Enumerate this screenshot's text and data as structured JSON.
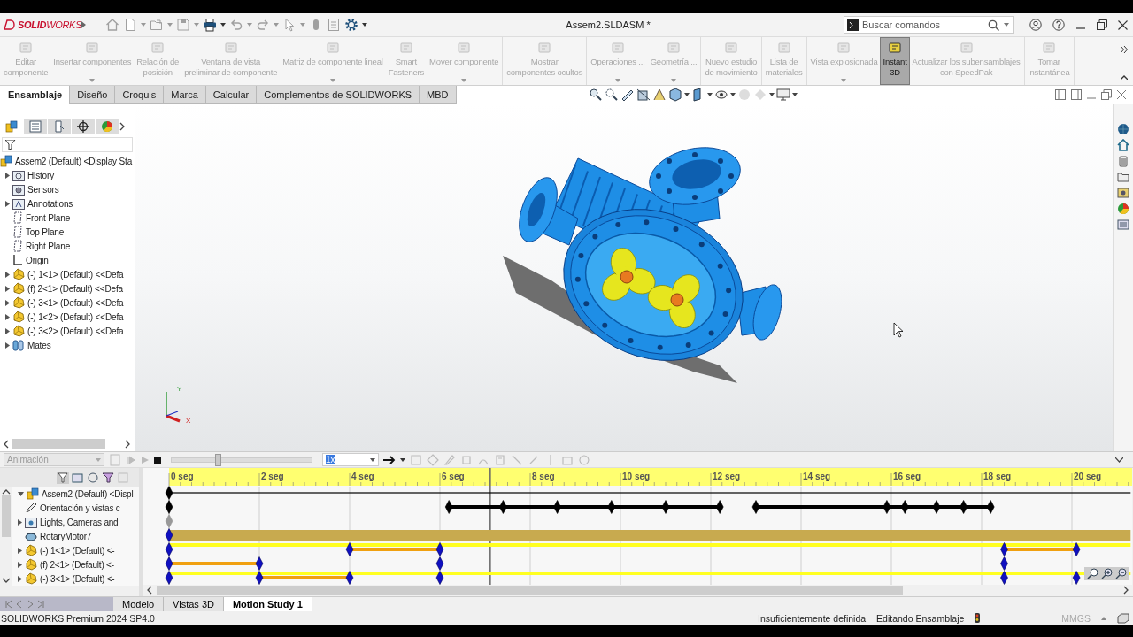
{
  "title_bar": {
    "logo": "**SOLID**WORKS",
    "title": "Assem2.SLDASM *",
    "search": {
      "placeholder": "Buscar comandos"
    },
    "quick_access": [
      {
        "kind": "home",
        "disabled": true,
        "dropdown": false
      },
      {
        "kind": "new",
        "disabled": true,
        "dropdown": true
      },
      {
        "kind": "open",
        "disabled": true,
        "dropdown": true
      },
      {
        "kind": "save",
        "disabled": true,
        "dropdown": true
      },
      {
        "kind": "print",
        "disabled": false,
        "dropdown": true
      },
      {
        "kind": "undo",
        "disabled": true,
        "dropdown": true
      },
      {
        "kind": "redo",
        "disabled": true,
        "dropdown": true
      },
      {
        "kind": "select",
        "disabled": true,
        "dropdown": true
      },
      {
        "kind": "rebuild",
        "disabled": true,
        "dropdown": false
      },
      {
        "kind": "properties",
        "disabled": true,
        "dropdown": false
      },
      {
        "kind": "options",
        "disabled": false,
        "dropdown": true
      }
    ]
  },
  "ribbon": {
    "groups": [
      [
        {
          "label": "Editar\ncomponente",
          "dropdown": false,
          "disabled": true,
          "selected": false
        },
        {
          "label": "Insertar componentes",
          "dropdown": true,
          "disabled": true,
          "selected": false
        },
        {
          "label": "Relación de\nposición",
          "dropdown": false,
          "disabled": true,
          "selected": false
        },
        {
          "label": "Ventana de vista\npreliminar de componente",
          "dropdown": false,
          "disabled": true,
          "selected": false
        },
        {
          "label": "Matriz de componente lineal",
          "dropdown": true,
          "disabled": true,
          "selected": false
        },
        {
          "label": "Smart\nFasteners",
          "dropdown": false,
          "disabled": true,
          "selected": false
        },
        {
          "label": "Mover componente",
          "dropdown": true,
          "disabled": true,
          "selected": false
        }
      ],
      [
        {
          "label": "Mostrar\ncomponentes ocultos",
          "dropdown": false,
          "disabled": true,
          "selected": false
        }
      ],
      [
        {
          "label": "Operaciones ...",
          "dropdown": true,
          "disabled": true,
          "selected": false
        },
        {
          "label": "Geometría ...",
          "dropdown": true,
          "disabled": true,
          "selected": false
        }
      ],
      [
        {
          "label": "Nuevo estudio\nde movimiento",
          "dropdown": false,
          "disabled": true,
          "selected": false
        }
      ],
      [
        {
          "label": "Lista de\nmateriales",
          "dropdown": false,
          "disabled": true,
          "selected": false
        }
      ],
      [
        {
          "label": "Vista explosionada",
          "dropdown": true,
          "disabled": true,
          "selected": false
        },
        {
          "label": "Instant\n3D",
          "dropdown": false,
          "disabled": false,
          "selected": true
        },
        {
          "label": "Actualizar los subensamblajes\ncon SpeedPak",
          "dropdown": false,
          "disabled": true,
          "selected": false
        }
      ],
      [
        {
          "label": "Tomar\ninstantánea",
          "dropdown": false,
          "disabled": true,
          "selected": false
        }
      ]
    ]
  },
  "tabs": [
    {
      "label": "Ensamblaje",
      "selected": true
    },
    {
      "label": "Diseño",
      "selected": false
    },
    {
      "label": "Croquis",
      "selected": false
    },
    {
      "label": "Marca",
      "selected": false
    },
    {
      "label": "Calcular",
      "selected": false
    },
    {
      "label": "Complementos de SOLIDWORKS",
      "selected": false
    },
    {
      "label": "MBD",
      "selected": false
    }
  ],
  "feature_tree": {
    "panel_tabs": [
      {
        "kind": "feature-tree",
        "selected": true
      },
      {
        "kind": "property-manager",
        "selected": false
      },
      {
        "kind": "configuration-manager",
        "selected": false
      },
      {
        "kind": "dimxpert",
        "selected": false
      },
      {
        "kind": "display-manager",
        "selected": false
      }
    ],
    "root": {
      "label": "Assem2 (Default) <Display Sta",
      "kind": "assembly",
      "children": [
        {
          "label": "History",
          "kind": "history",
          "expandable": true,
          "expanded": false
        },
        {
          "label": "Sensors",
          "kind": "sensor",
          "expandable": false
        },
        {
          "label": "Annotations",
          "kind": "annotation",
          "expandable": true,
          "expanded": false
        },
        {
          "label": "Front Plane",
          "kind": "plane",
          "expandable": false
        },
        {
          "label": "Top Plane",
          "kind": "plane",
          "expandable": false
        },
        {
          "label": "Right Plane",
          "kind": "plane",
          "expandable": false
        },
        {
          "label": "Origin",
          "kind": "origin",
          "expandable": false
        },
        {
          "label": "(-) 1<1> (Default) <<Defa",
          "kind": "part",
          "expandable": true,
          "expanded": false
        },
        {
          "label": "(f) 2<1> (Default) <<Defa",
          "kind": "part",
          "expandable": true,
          "expanded": false
        },
        {
          "label": "(-) 3<1> (Default) <<Defa",
          "kind": "part",
          "expandable": true,
          "expanded": false
        },
        {
          "label": "(-) 1<2> (Default) <<Defa",
          "kind": "part",
          "expandable": true,
          "expanded": false
        },
        {
          "label": "(-) 3<2> (Default) <<Defa",
          "kind": "part",
          "expandable": true,
          "expanded": false
        },
        {
          "label": "Mates",
          "kind": "mates",
          "expandable": true,
          "expanded": false
        }
      ]
    }
  },
  "viewport": {
    "triad": {
      "y_label": "Y",
      "x_label": "X"
    }
  },
  "motion_manager": {
    "study_type": {
      "value": "Animación",
      "disabled": true
    },
    "slider": {
      "level": 0.33
    },
    "speed": {
      "value": "1x",
      "highlighted": true
    },
    "tree": [
      {
        "label": "Assem2 (Default) <Displ",
        "kind": "assembly",
        "expandable": true,
        "expanded": true
      },
      {
        "label": "Orientación y vistas c",
        "kind": "orientation",
        "expandable": false
      },
      {
        "label": "Lights, Cameras and",
        "kind": "lights",
        "expandable": true,
        "expanded": false
      },
      {
        "label": "RotaryMotor7",
        "kind": "motor",
        "expandable": false
      },
      {
        "label": "(-) 1<1> (Default) <-",
        "kind": "part",
        "expandable": true,
        "expanded": false
      },
      {
        "label": "(f) 2<1> (Default) <-",
        "kind": "part",
        "expandable": true,
        "expanded": false
      },
      {
        "label": "(-) 3<1> (Default) <-",
        "kind": "part",
        "expandable": true,
        "expanded": false
      }
    ],
    "timeline": {
      "ruler_labels": [
        "0 seg",
        "2 seg",
        "4 seg",
        "6 seg",
        "8 seg",
        "10 seg",
        "12 seg",
        "14 seg",
        "16 seg",
        "18 seg",
        "20 seg"
      ]
    }
  },
  "bottom_tabs": [
    {
      "label": "Modelo",
      "selected": false
    },
    {
      "label": "Vistas 3D",
      "selected": false
    },
    {
      "label": "Motion Study 1",
      "selected": true
    }
  ],
  "status_bar": {
    "product": "SOLIDWORKS Premium 2024 SP4.0",
    "definition": "Insuficientemente definida",
    "mode": "Editando Ensamblaje",
    "units": "MMGS"
  }
}
